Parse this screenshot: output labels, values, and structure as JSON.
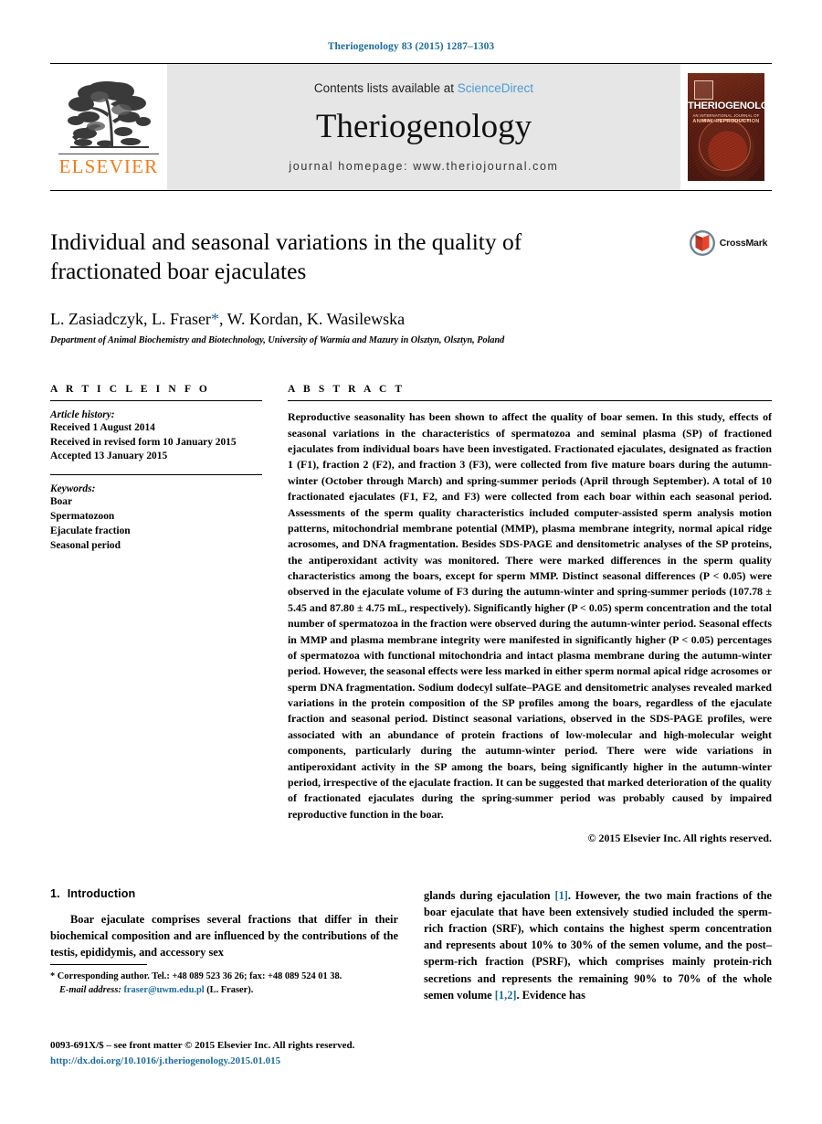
{
  "running_head": "Theriogenology 83 (2015) 1287–1303",
  "masthead": {
    "publisher_name": "ELSEVIER",
    "contents_prefix": "Contents lists available at",
    "contents_link": "ScienceDirect",
    "journal_name": "Theriogenology",
    "homepage": "journal homepage: www.theriojournal.com",
    "cover": {
      "title": "THERIOGENOLOGY",
      "subtitle": "AN INTERNATIONAL JOURNAL OF ANIMAL REPRODUCTION",
      "subtitle2": "ANIMAL  REPRODUCTION"
    }
  },
  "article": {
    "title": "Individual and seasonal variations in the quality of fractionated boar ejaculates",
    "authors": "L. Zasiadczyk, L. Fraser",
    "authors_star": "*",
    "authors_rest": ", W. Kordan, K. Wasilewska",
    "affiliation": "Department of Animal Biochemistry and Biotechnology, University of Warmia and Mazury in Olsztyn, Olsztyn, Poland",
    "crossmark_label": "CrossMark"
  },
  "info": {
    "heading": "A R T I C L E   I N F O",
    "history_label": "Article history:",
    "history": [
      "Received 1 August 2014",
      "Received in revised form 10 January 2015",
      "Accepted 13 January 2015"
    ],
    "keywords_label": "Keywords:",
    "keywords": [
      "Boar",
      "Spermatozoon",
      "Ejaculate fraction",
      "Seasonal period"
    ]
  },
  "abstract": {
    "heading": "A B S T R A C T",
    "text": "Reproductive seasonality has been shown to affect the quality of boar semen. In this study, effects of seasonal variations in the characteristics of spermatozoa and seminal plasma (SP) of fractioned ejaculates from individual boars have been investigated. Fractionated ejaculates, designated as fraction 1 (F1), fraction 2 (F2), and fraction 3 (F3), were collected from five mature boars during the autumn-winter (October through March) and spring-summer periods (April through September). A total of 10 fractionated ejaculates (F1, F2, and F3) were collected from each boar within each seasonal period. Assessments of the sperm quality characteristics included computer-assisted sperm analysis motion patterns, mitochondrial membrane potential (MMP), plasma membrane integrity, normal apical ridge acrosomes, and DNA fragmentation. Besides SDS-PAGE and densitometric analyses of the SP proteins, the antiperoxidant activity was monitored. There were marked differences in the sperm quality characteristics among the boars, except for sperm MMP. Distinct seasonal differences (P < 0.05) were observed in the ejaculate volume of F3 during the autumn-winter and spring-summer periods (107.78 ± 5.45 and 87.80 ± 4.75 mL, respectively). Significantly higher (P < 0.05) sperm concentration and the total number of spermatozoa in the fraction were observed during the autumn-winter period. Seasonal effects in MMP and plasma membrane integrity were manifested in significantly higher (P < 0.05) percentages of spermatozoa with functional mitochondria and intact plasma membrane during the autumn-winter period. However, the seasonal effects were less marked in either sperm normal apical ridge acrosomes or sperm DNA fragmentation. Sodium dodecyl sulfate–PAGE and densitometric analyses revealed marked variations in the protein composition of the SP profiles among the boars, regardless of the ejaculate fraction and seasonal period. Distinct seasonal variations, observed in the SDS-PAGE profiles, were associated with an abundance of protein fractions of low-molecular and high-molecular weight components, particularly during the autumn-winter period. There were wide variations in antiperoxidant activity in the SP among the boars, being significantly higher in the autumn-winter period, irrespective of the ejaculate fraction. It can be suggested that marked deterioration of the quality of fractionated ejaculates during the spring-summer period was probably caused by impaired reproductive function in the boar.",
    "copyright": "© 2015 Elsevier Inc. All rights reserved."
  },
  "body": {
    "section_number": "1.",
    "section_title": "Introduction",
    "left_paragraph": "Boar ejaculate comprises several fractions that differ in their biochemical composition and are influenced by the contributions of the testis, epididymis, and accessory sex",
    "right_paragraph_part1": "glands during ejaculation ",
    "right_ref1": "[1]",
    "right_paragraph_part2": ". However, the two main fractions of the boar ejaculate that have been extensively studied included the sperm-rich fraction (SRF), which contains the highest sperm concentration and represents about 10% to 30% of the semen volume, and the post–sperm-rich fraction (PSRF), which comprises mainly protein-rich secretions and represents the remaining 90% to 70% of the whole semen volume ",
    "right_ref2": "[1,2]",
    "right_paragraph_part3": ". Evidence has"
  },
  "footnote": {
    "marker": "*",
    "text_before_email": " Corresponding author. Tel.: +48 089 523 36 26; fax: +48 089 524 01 38.",
    "email_label": "E-mail address:",
    "email": "fraser@uwm.edu.pl",
    "email_suffix": " (L. Fraser)."
  },
  "imprint": {
    "issn_line": "0093-691X/$ – see front matter © 2015 Elsevier Inc. All rights reserved.",
    "doi": "http://dx.doi.org/10.1016/j.theriogenology.2015.01.015"
  },
  "colors": {
    "link_blue": "#1a6b9c",
    "sciencedirect_blue": "#4a9bd1",
    "elsevier_orange": "#ef7d1a"
  }
}
